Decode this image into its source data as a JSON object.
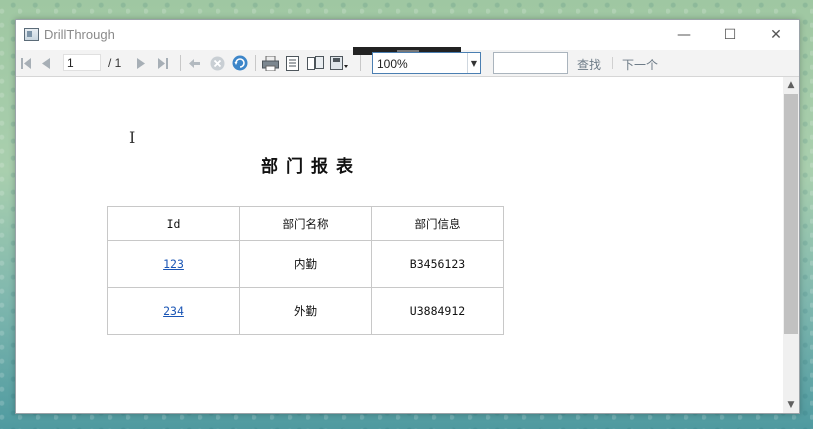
{
  "window": {
    "title": "DrillThrough",
    "controls": {
      "minimize": "—",
      "maximize": "☐",
      "close": "✕"
    }
  },
  "toolbar": {
    "current_page": "1",
    "total_pages": "/ 1",
    "zoom": "100%",
    "search_placeholder": "",
    "find_label": "查找",
    "next_label": "下一个",
    "icons": [
      "first-page-icon",
      "prev-page-icon",
      "next-page-icon",
      "last-page-icon",
      "back-icon",
      "stop-icon",
      "refresh-icon",
      "print-icon",
      "print-layout-icon",
      "page-setup-icon",
      "export-icon"
    ]
  },
  "report": {
    "title": "部门报表",
    "columns": [
      "Id",
      "部门名称",
      "部门信息"
    ],
    "rows": [
      {
        "id": "123",
        "name": "内勤",
        "info": "B3456123"
      },
      {
        "id": "234",
        "name": "外勤",
        "info": "U3884912"
      }
    ]
  },
  "colors": {
    "accent": "#4b7fb2",
    "link": "#1a55b5"
  }
}
